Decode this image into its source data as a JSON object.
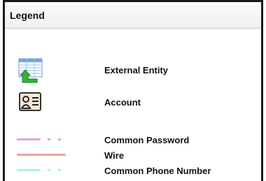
{
  "header": {
    "title": "Legend"
  },
  "items": [
    {
      "label": "External Entity",
      "icon": "table-with-green-arrow-icon"
    },
    {
      "label": "Account",
      "icon": "contact-card-icon"
    }
  ],
  "lines": [
    {
      "label": "Common Password",
      "color": "#d8a4dc",
      "style": "dash-dot"
    },
    {
      "label": "Wire",
      "color": "#f4a1a1",
      "style": "solid"
    },
    {
      "label": "Common Phone Number",
      "color": "#a9f3f0",
      "style": "dash-dot"
    }
  ]
}
